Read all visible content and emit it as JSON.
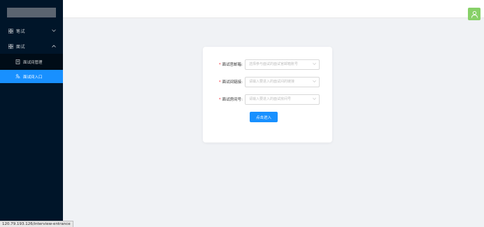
{
  "sidebar": {
    "menus": [
      {
        "label": "笔试",
        "icon": "grid-icon",
        "expanded": false
      },
      {
        "label": "面试",
        "icon": "grid-icon",
        "expanded": true
      }
    ],
    "submenu": [
      {
        "label": "面试间管理",
        "icon": "document-icon",
        "active": false
      },
      {
        "label": "面试间入口",
        "icon": "user-search-icon",
        "active": true
      }
    ]
  },
  "header": {
    "avatar_icon": "user-icon",
    "avatar_color": "#87d068"
  },
  "form": {
    "fields": [
      {
        "label": "面试官邮箱:",
        "placeholder": "选择参与面试的面试官邮箱账号"
      },
      {
        "label": "面试间链接:",
        "placeholder": "请输入要进入的面试间的链接"
      },
      {
        "label": "面试房间号:",
        "placeholder": "请输入要进入的面试房间号"
      }
    ],
    "submit_label": "点击进入"
  },
  "status_url": "120.79.193.126/interview-entrance",
  "colors": {
    "sidebar": "#001529",
    "accent": "#1890ff",
    "required": "#f5222d"
  }
}
